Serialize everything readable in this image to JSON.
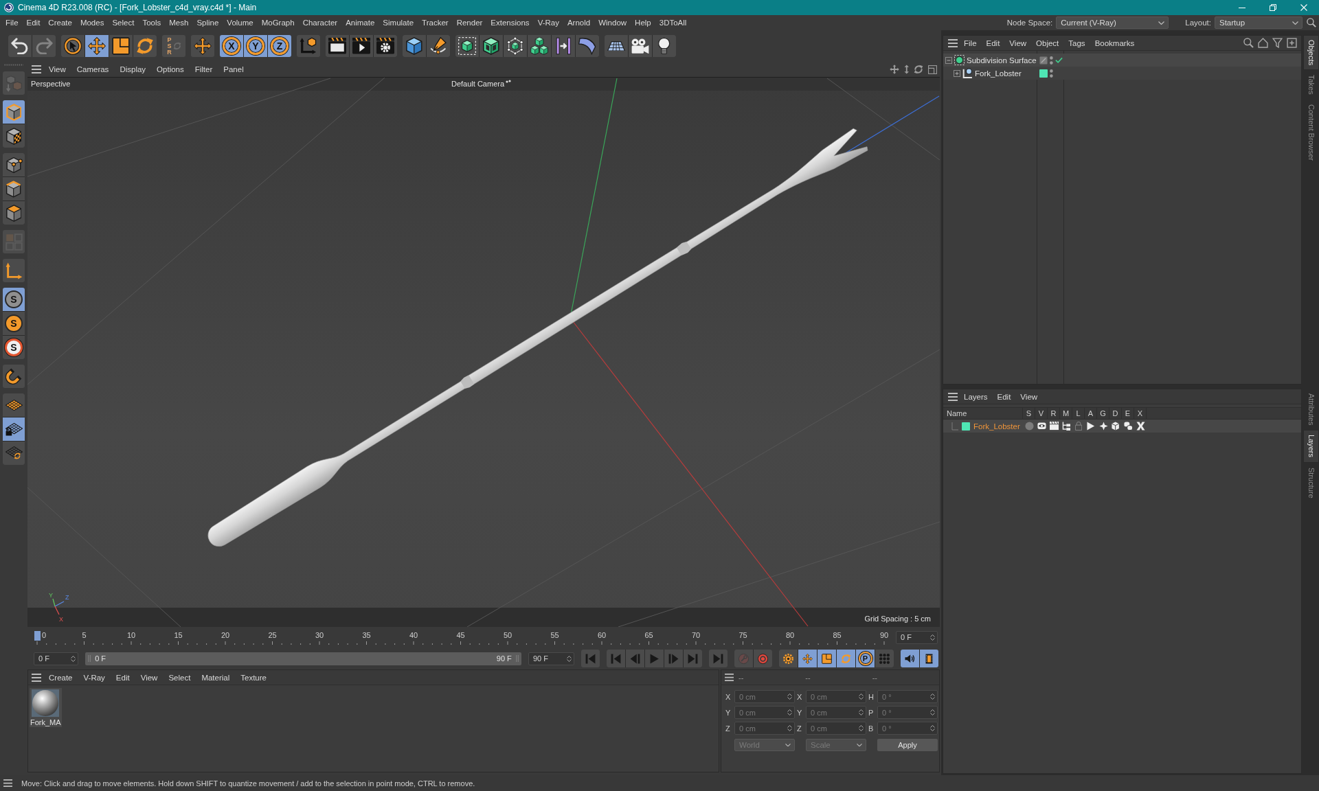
{
  "window": {
    "title": "Cinema 4D R23.008 (RC) - [Fork_Lobster_c4d_vray.c4d *] - Main"
  },
  "menu_bar": {
    "items": [
      "File",
      "Edit",
      "Create",
      "Modes",
      "Select",
      "Tools",
      "Mesh",
      "Spline",
      "Volume",
      "MoGraph",
      "Character",
      "Animate",
      "Simulate",
      "Tracker",
      "Render",
      "Extensions",
      "V-Ray",
      "Arnold",
      "Window",
      "Help",
      "3DToAll"
    ],
    "node_space": {
      "label": "Node Space:",
      "value": "Current (V-Ray)"
    },
    "layout": {
      "label": "Layout:",
      "value": "Startup"
    }
  },
  "toolbar": {
    "groups": [
      [
        {
          "kind": "undo",
          "on": false,
          "disabled": false
        },
        {
          "kind": "redo",
          "on": false,
          "disabled": true
        }
      ],
      [
        {
          "kind": "select",
          "on": false,
          "disabled": false
        },
        {
          "kind": "move",
          "on": true,
          "disabled": false
        },
        {
          "kind": "scale",
          "on": false,
          "disabled": false
        },
        {
          "kind": "rotate",
          "on": false,
          "disabled": false
        }
      ],
      [
        {
          "kind": "psr",
          "label": "PSR",
          "on": false,
          "disabled": true
        }
      ],
      [
        {
          "kind": "transform",
          "on": false,
          "disabled": false
        }
      ],
      [
        {
          "kind": "axis",
          "label": "X",
          "on": true,
          "disabled": false
        },
        {
          "kind": "axis",
          "label": "Y",
          "on": true,
          "disabled": false
        },
        {
          "kind": "axis",
          "label": "Z",
          "on": true,
          "disabled": false
        }
      ],
      [
        {
          "kind": "coords",
          "on": false,
          "disabled": false
        }
      ],
      [
        {
          "kind": "renderview",
          "on": false,
          "disabled": false
        },
        {
          "kind": "render",
          "on": false,
          "disabled": false
        },
        {
          "kind": "rendersettings",
          "on": false,
          "disabled": false
        }
      ],
      [
        {
          "kind": "cube",
          "on": false,
          "disabled": false
        },
        {
          "kind": "pen",
          "on": false,
          "disabled": false
        }
      ],
      [
        {
          "kind": "subdivision",
          "on": false,
          "disabled": false
        },
        {
          "kind": "extrude",
          "on": false,
          "disabled": false
        },
        {
          "kind": "cloner",
          "on": false,
          "disabled": false
        },
        {
          "kind": "array",
          "on": false,
          "disabled": false
        },
        {
          "kind": "symmetry",
          "on": false,
          "disabled": false
        },
        {
          "kind": "deformer",
          "on": false,
          "disabled": false
        }
      ],
      [
        {
          "kind": "floor",
          "on": false,
          "disabled": false
        },
        {
          "kind": "camera",
          "on": false,
          "disabled": false
        },
        {
          "kind": "light",
          "on": false,
          "disabled": false
        }
      ]
    ]
  },
  "mode_toolbar": {
    "groups": [
      [
        {
          "kind": "editable",
          "on": false,
          "disabled": true
        }
      ],
      [
        {
          "kind": "model",
          "on": true,
          "disabled": false
        },
        {
          "kind": "texture",
          "on": false,
          "disabled": false
        }
      ],
      [
        {
          "kind": "point",
          "on": false,
          "disabled": false
        },
        {
          "kind": "edge",
          "on": false,
          "disabled": false
        },
        {
          "kind": "polygon",
          "on": false,
          "disabled": false
        }
      ],
      [
        {
          "kind": "uv",
          "on": false,
          "disabled": true
        }
      ],
      [
        {
          "kind": "axes",
          "on": false,
          "disabled": false
        }
      ],
      [
        {
          "kind": "snap",
          "label": "S",
          "on": true,
          "disabled": false
        },
        {
          "kind": "snapsolid",
          "label": "S",
          "on": false,
          "disabled": false
        },
        {
          "kind": "snapring",
          "label": "S",
          "on": false,
          "disabled": false
        }
      ],
      [
        {
          "kind": "magnet",
          "on": false,
          "disabled": false
        }
      ],
      [
        {
          "kind": "workplane",
          "on": false,
          "disabled": false
        },
        {
          "kind": "workplanelock",
          "on": true,
          "disabled": false
        },
        {
          "kind": "workplanerotate",
          "on": false,
          "disabled": false
        }
      ]
    ]
  },
  "viewport": {
    "menu": [
      "View",
      "Cameras",
      "Display",
      "Options",
      "Filter",
      "Panel"
    ],
    "view_name": "Perspective",
    "camera": "Default Camera",
    "axis_labels": [
      "Y",
      "Z",
      "X"
    ],
    "grid_spacing": "Grid Spacing : 5 cm"
  },
  "timeline": {
    "ticks": [
      "0",
      "5",
      "10",
      "15",
      "20",
      "25",
      "30",
      "35",
      "40",
      "45",
      "50",
      "55",
      "60",
      "65",
      "70",
      "75",
      "80",
      "85",
      "90"
    ],
    "level": 0,
    "current_frame": "0 F"
  },
  "playback": {
    "start_frame": "0 F",
    "range": {
      "start": "0 F",
      "end": "90 F"
    },
    "end_frame": "90 F",
    "groups": [
      [
        {
          "kind": "start",
          "on": false,
          "disabled": false
        }
      ],
      [
        {
          "kind": "prevkey",
          "on": false,
          "disabled": false
        },
        {
          "kind": "prevframe",
          "on": false,
          "disabled": false
        },
        {
          "kind": "play",
          "on": false,
          "disabled": false
        },
        {
          "kind": "nextframe",
          "on": false,
          "disabled": false
        },
        {
          "kind": "nextkey",
          "on": false,
          "disabled": false
        }
      ],
      [
        {
          "kind": "end",
          "on": false,
          "disabled": false
        }
      ],
      [
        {
          "kind": "recordkey",
          "on": false,
          "disabled": true
        },
        {
          "kind": "autokey",
          "on": false,
          "disabled": false
        }
      ],
      [
        {
          "kind": "keyframe",
          "on": false,
          "disabled": false
        },
        {
          "kind": "keymove",
          "on": true,
          "disabled": false
        },
        {
          "kind": "keyscale",
          "on": true,
          "disabled": false
        },
        {
          "kind": "keyrotate",
          "on": true,
          "disabled": false
        },
        {
          "kind": "keyparam",
          "label": "P",
          "on": true,
          "disabled": false
        },
        {
          "kind": "keypla",
          "on": false,
          "disabled": false
        }
      ],
      [
        {
          "kind": "sound",
          "on": true,
          "disabled": false
        },
        {
          "kind": "film",
          "on": true,
          "disabled": false
        }
      ]
    ]
  },
  "material_manager": {
    "menu": [
      "Create",
      "V-Ray",
      "Edit",
      "View",
      "Select",
      "Material",
      "Texture"
    ],
    "materials": [
      {
        "name": "Fork_MA"
      }
    ]
  },
  "coordinates": {
    "headers": [
      "--",
      "--",
      "--"
    ],
    "disabled": true,
    "rows": [
      {
        "position_axis": "X",
        "position": "0 cm",
        "size_axis": "X",
        "size": "0 cm",
        "rotation_axis": "H",
        "rotation": "0 °"
      },
      {
        "position_axis": "Y",
        "position": "0 cm",
        "size_axis": "Y",
        "size": "0 cm",
        "rotation_axis": "P",
        "rotation": "0 °"
      },
      {
        "position_axis": "Z",
        "position": "0 cm",
        "size_axis": "Z",
        "size": "0 cm",
        "rotation_axis": "B",
        "rotation": "0 °"
      }
    ],
    "position_mode": "World",
    "size_mode": "Scale",
    "apply": "Apply"
  },
  "status_bar": {
    "message": "Move: Click and drag to move elements. Hold down SHIFT to quantize movement / add to the selection in point mode, CTRL to remove."
  },
  "object_manager": {
    "menu": [
      "File",
      "Edit",
      "View",
      "Object",
      "Tags",
      "Bookmarks"
    ],
    "objects": [
      {
        "name": "Subdivision Surface",
        "kind": "subdivision",
        "expanded": true,
        "enabled": true,
        "children": [
          {
            "name": "Fork_Lobster",
            "kind": "polygon",
            "expanded": false,
            "color": "#4fe6b4"
          }
        ]
      }
    ]
  },
  "layer_manager": {
    "menu": [
      "Layers",
      "Edit",
      "View"
    ],
    "columns": [
      "Name",
      "S",
      "V",
      "R",
      "M",
      "L",
      "A",
      "G",
      "D",
      "E",
      "X"
    ],
    "layers": [
      {
        "name": "Fork_Lobster",
        "color": "#4fe6b4",
        "selected": true,
        "solo": false,
        "view": true,
        "render": true,
        "manager": true,
        "locked": false,
        "animation": true,
        "generators": true,
        "deformers": true,
        "expressions": true,
        "xref": true
      }
    ]
  },
  "dock_tabs": {
    "top": [
      {
        "label": "Objects",
        "selected": true
      },
      {
        "label": "Takes",
        "selected": false
      },
      {
        "label": "Content Browser",
        "selected": false
      }
    ],
    "bottom": [
      {
        "label": "Attributes",
        "selected": false
      },
      {
        "label": "Layers",
        "selected": true
      },
      {
        "label": "Structure",
        "selected": false
      }
    ]
  }
}
